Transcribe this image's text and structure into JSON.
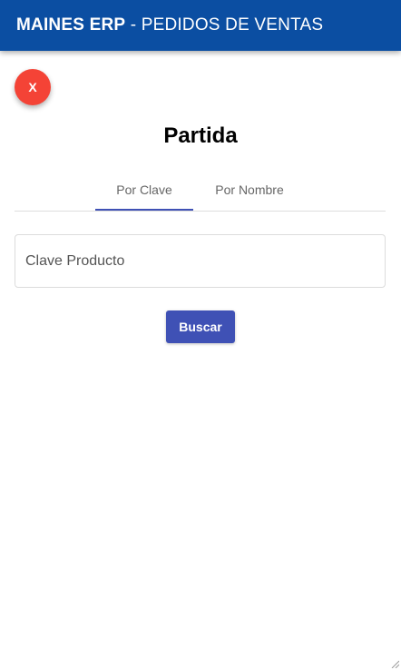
{
  "app_bar": {
    "brand": "MAINES ERP",
    "separator": " - ",
    "section": "PEDIDOS DE VENTAS",
    "background": "#0b4ea2"
  },
  "close_button": {
    "label": "X",
    "color": "#f44336"
  },
  "page": {
    "title": "Partida"
  },
  "tabs": [
    {
      "label": "Por Clave",
      "active": true
    },
    {
      "label": "Por Nombre",
      "active": false
    }
  ],
  "search_field": {
    "placeholder": "Clave Producto",
    "value": ""
  },
  "search_button": {
    "label": "Buscar",
    "color": "#3f51b5"
  },
  "icons": {
    "resize": "resize-grip-icon"
  }
}
